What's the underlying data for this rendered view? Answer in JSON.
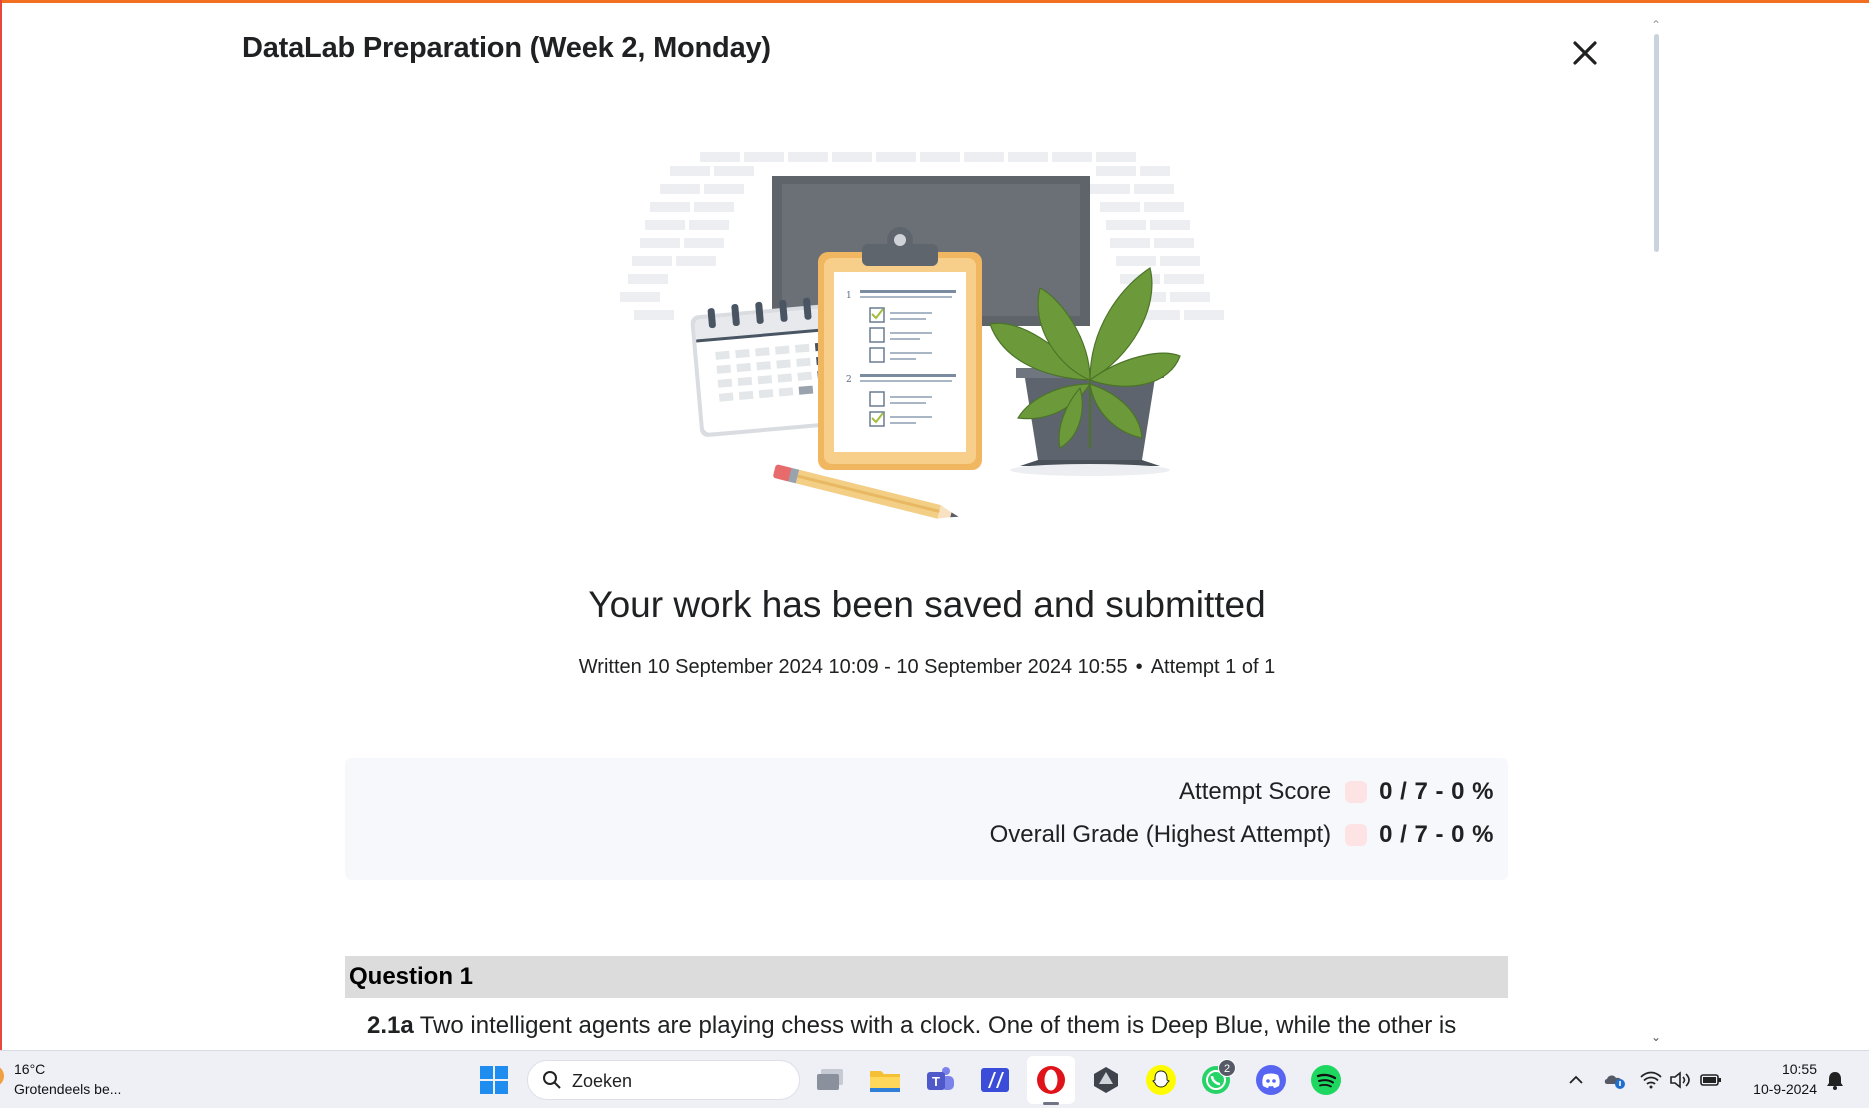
{
  "dialog": {
    "title": "DataLab Preparation (Week 2, Monday)",
    "close_icon": "close-icon"
  },
  "result": {
    "headline": "Your work has been saved and submitted",
    "written": "Written 10 September 2024 10:09 - 10 September 2024 10:55",
    "separator": "•",
    "attempt": "Attempt 1 of 1"
  },
  "scores": {
    "attempt_label": "Attempt Score",
    "attempt_value": "0 / 7 - 0 %",
    "overall_label": "Overall Grade (Highest Attempt)",
    "overall_value": "0 / 7 - 0 %",
    "status_color": "#fde3e3"
  },
  "question": {
    "title": "Question 1",
    "number": "2.1a",
    "text": "Two intelligent agents are playing chess with a clock. One of them is Deep Blue, while the other is"
  },
  "illustration": {
    "icon": "clipboard-checklist-illustration",
    "item_numbers": [
      "1",
      "2"
    ]
  },
  "taskbar": {
    "weather_temp": "16°C",
    "weather_desc": "Grotendeels be...",
    "search_placeholder": "Zoeken",
    "whatsapp_badge": "2",
    "apps": [
      "windows-start-icon",
      "task-view-icon",
      "file-explorer-icon",
      "teams-icon",
      "app-icon",
      "opera-icon",
      "app-icon",
      "snapchat-icon",
      "whatsapp-icon",
      "discord-icon",
      "spotify-icon"
    ],
    "clock_time": "10:55",
    "clock_date": "10-9-2024"
  },
  "colors": {
    "accent_top": "#f26f21",
    "question_bar": "#dcdcdc",
    "panel_bg": "#f6f8fb"
  }
}
